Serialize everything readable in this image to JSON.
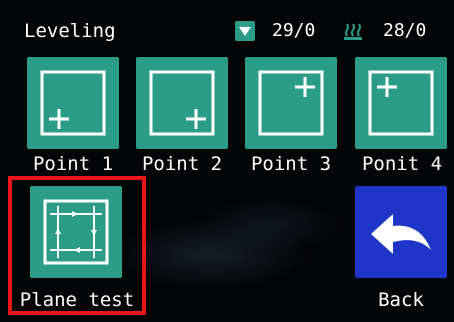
{
  "header": {
    "title": "Leveling",
    "nozzle": {
      "icon": "nozzle-temp-icon",
      "value": "29/0"
    },
    "bed": {
      "icon": "bed-temp-icon",
      "value": "28/0"
    }
  },
  "points": [
    {
      "label": "Point 1",
      "icon": "point-bottom-left-icon"
    },
    {
      "label": "Point 2",
      "icon": "point-bottom-right-icon"
    },
    {
      "label": "Point 3",
      "icon": "point-top-right-icon"
    },
    {
      "label": "Ponit 4",
      "icon": "point-top-left-icon"
    }
  ],
  "plane_test": {
    "label": "Plane test",
    "icon": "plane-test-icon",
    "selected": true
  },
  "back": {
    "label": "Back",
    "icon": "back-arrow-icon"
  },
  "colors": {
    "tile": "#2a9c88",
    "back_tile": "#1f35c8",
    "highlight": "#e8141c",
    "text": "#ffffff"
  }
}
